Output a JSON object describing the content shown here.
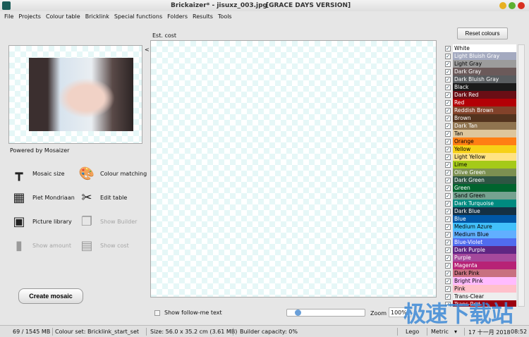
{
  "window": {
    "title": "Brickaizer* - jisuxz_003.jpg",
    "version": "[GRACE DAYS VERSION]"
  },
  "menu": [
    "File",
    "Projects",
    "Colour table",
    "Bricklink",
    "Special functions",
    "Folders",
    "Results",
    "Tools"
  ],
  "preview": {
    "collapse": "<",
    "powered": "Powered by Mosaizer"
  },
  "tools": [
    {
      "label": "Mosaic size",
      "icon": "ruler-icon"
    },
    {
      "label": "Colour matching",
      "icon": "palette-icon"
    },
    {
      "label": "Piet Mondriaan",
      "icon": "grid-icon"
    },
    {
      "label": "Edit table",
      "icon": "scissors-icon"
    },
    {
      "label": "Picture library",
      "icon": "stamp-icon"
    },
    {
      "label": "Show Builder",
      "icon": "documents-icon"
    },
    {
      "label": "Show amount",
      "icon": "bar-chart-icon"
    },
    {
      "label": "Show cost",
      "icon": "calculator-icon"
    }
  ],
  "create_label": "Create mosaic",
  "est_cost": "Est. cost",
  "follow_label": "Show follow-me text",
  "zoom": {
    "label": "Zoom",
    "value": "100%",
    "slider_fraction": 0.1
  },
  "reset_label": "Reset colours",
  "colours": [
    {
      "name": "White",
      "bg": "#ffffff",
      "fg": "#000"
    },
    {
      "name": "Light Bluish Gray",
      "bg": "#a4aac0",
      "fg": "#fff"
    },
    {
      "name": "Light Gray",
      "bg": "#9c9c9c",
      "fg": "#000"
    },
    {
      "name": "Dark Gray",
      "bg": "#6b5a5a",
      "fg": "#fff"
    },
    {
      "name": "Dark Bluish Gray",
      "bg": "#595d60",
      "fg": "#fff"
    },
    {
      "name": "Black",
      "bg": "#1b1b1b",
      "fg": "#fff"
    },
    {
      "name": "Dark Red",
      "bg": "#6a0e15",
      "fg": "#fff"
    },
    {
      "name": "Red",
      "bg": "#b30006",
      "fg": "#fff"
    },
    {
      "name": "Reddish Brown",
      "bg": "#82422a",
      "fg": "#fff"
    },
    {
      "name": "Brown",
      "bg": "#53331e",
      "fg": "#fff"
    },
    {
      "name": "Dark Tan",
      "bg": "#907450",
      "fg": "#fff"
    },
    {
      "name": "Tan",
      "bg": "#dec69c",
      "fg": "#000"
    },
    {
      "name": "Orange",
      "bg": "#ff7e14",
      "fg": "#000"
    },
    {
      "name": "Yellow",
      "bg": "#f7d117",
      "fg": "#000"
    },
    {
      "name": "Light Yellow",
      "bg": "#ffe383",
      "fg": "#000"
    },
    {
      "name": "Lime",
      "bg": "#a5ca18",
      "fg": "#000"
    },
    {
      "name": "Olive Green",
      "bg": "#7c9051",
      "fg": "#fff"
    },
    {
      "name": "Dark Green",
      "bg": "#2e5543",
      "fg": "#fff"
    },
    {
      "name": "Green",
      "bg": "#00642e",
      "fg": "#fff"
    },
    {
      "name": "Sand Green",
      "bg": "#76a290",
      "fg": "#000"
    },
    {
      "name": "Dark Turquoise",
      "bg": "#008a80",
      "fg": "#fff"
    },
    {
      "name": "Dark Blue",
      "bg": "#143044",
      "fg": "#fff"
    },
    {
      "name": "Blue",
      "bg": "#0057a6",
      "fg": "#fff"
    },
    {
      "name": "Medium Azure",
      "bg": "#42c0fb",
      "fg": "#000"
    },
    {
      "name": "Medium Blue",
      "bg": "#61afff",
      "fg": "#000"
    },
    {
      "name": "Blue-Violet",
      "bg": "#506cef",
      "fg": "#fff"
    },
    {
      "name": "Dark Purple",
      "bg": "#5f2683",
      "fg": "#fff"
    },
    {
      "name": "Purple",
      "bg": "#a5499c",
      "fg": "#fff"
    },
    {
      "name": "Magenta",
      "bg": "#b72276",
      "fg": "#fff"
    },
    {
      "name": "Dark Pink",
      "bg": "#c87080",
      "fg": "#000"
    },
    {
      "name": "Bright Pink",
      "bg": "#ffbbff",
      "fg": "#000"
    },
    {
      "name": "Pink",
      "bg": "#ffc0cb",
      "fg": "#000"
    },
    {
      "name": "Trans-Clear",
      "bg": "#eeeeee",
      "fg": "#000"
    },
    {
      "name": "Trans-Red",
      "bg": "#9c0010",
      "fg": "#fff"
    }
  ],
  "status": {
    "memory": "69 / 1545 MB",
    "colour_set": "Colour set: Bricklink_start_set",
    "size": "Size: 56.0 x 35.2 cm (3.61 MB)",
    "builder": "Builder capacity: 0%",
    "brand": "Lego",
    "units": "Metric",
    "date": "17 十一月 2018",
    "time": "08:52"
  },
  "watermark": "极速下载站"
}
